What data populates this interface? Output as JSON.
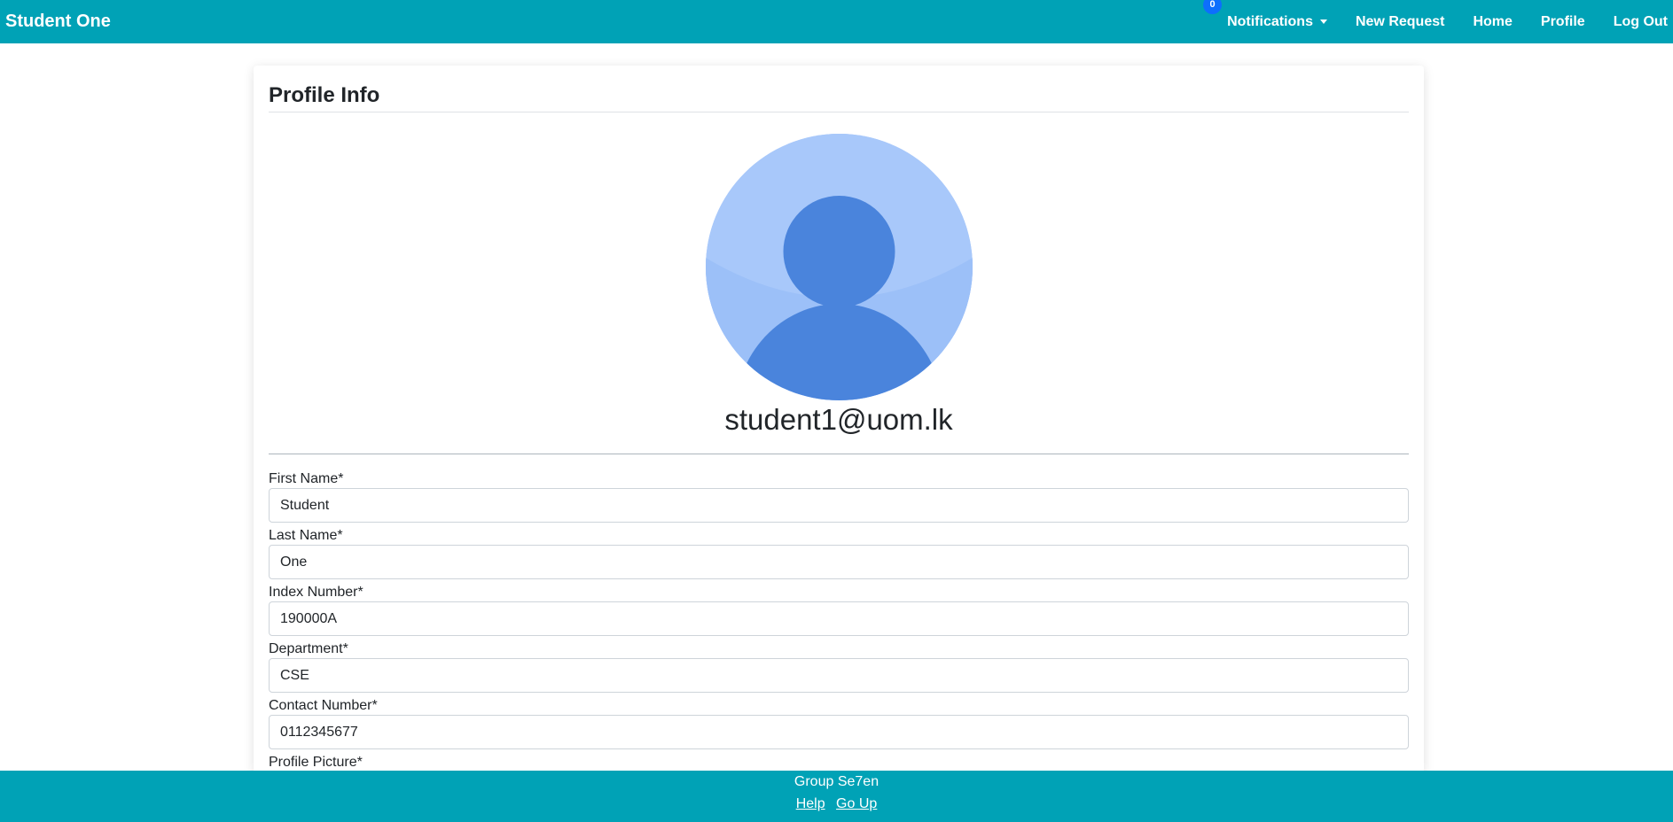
{
  "navbar": {
    "brand": "Student One",
    "notifications_count": "0",
    "notifications_label": "Notifications",
    "new_request_label": "New Request",
    "home_label": "Home",
    "profile_label": "Profile",
    "logout_label": "Log Out"
  },
  "profile": {
    "title": "Profile Info",
    "email": "student1@uom.lk",
    "fields": [
      {
        "label": "First Name*",
        "value": "Student"
      },
      {
        "label": "Last Name*",
        "value": "One"
      },
      {
        "label": "Index Number*",
        "value": "190000A"
      },
      {
        "label": "Department*",
        "value": "CSE"
      },
      {
        "label": "Contact Number*",
        "value": "0112345677"
      }
    ],
    "picture_label": "Profile Picture*"
  },
  "footer": {
    "text": "Group Se7en",
    "help_label": "Help",
    "go_up_label": "Go Up"
  },
  "colors": {
    "brand": "#00a2b6",
    "badge": "#0d6efd",
    "avatar_bg": "#a8c8fa",
    "avatar_figure": "#4a84dc"
  }
}
